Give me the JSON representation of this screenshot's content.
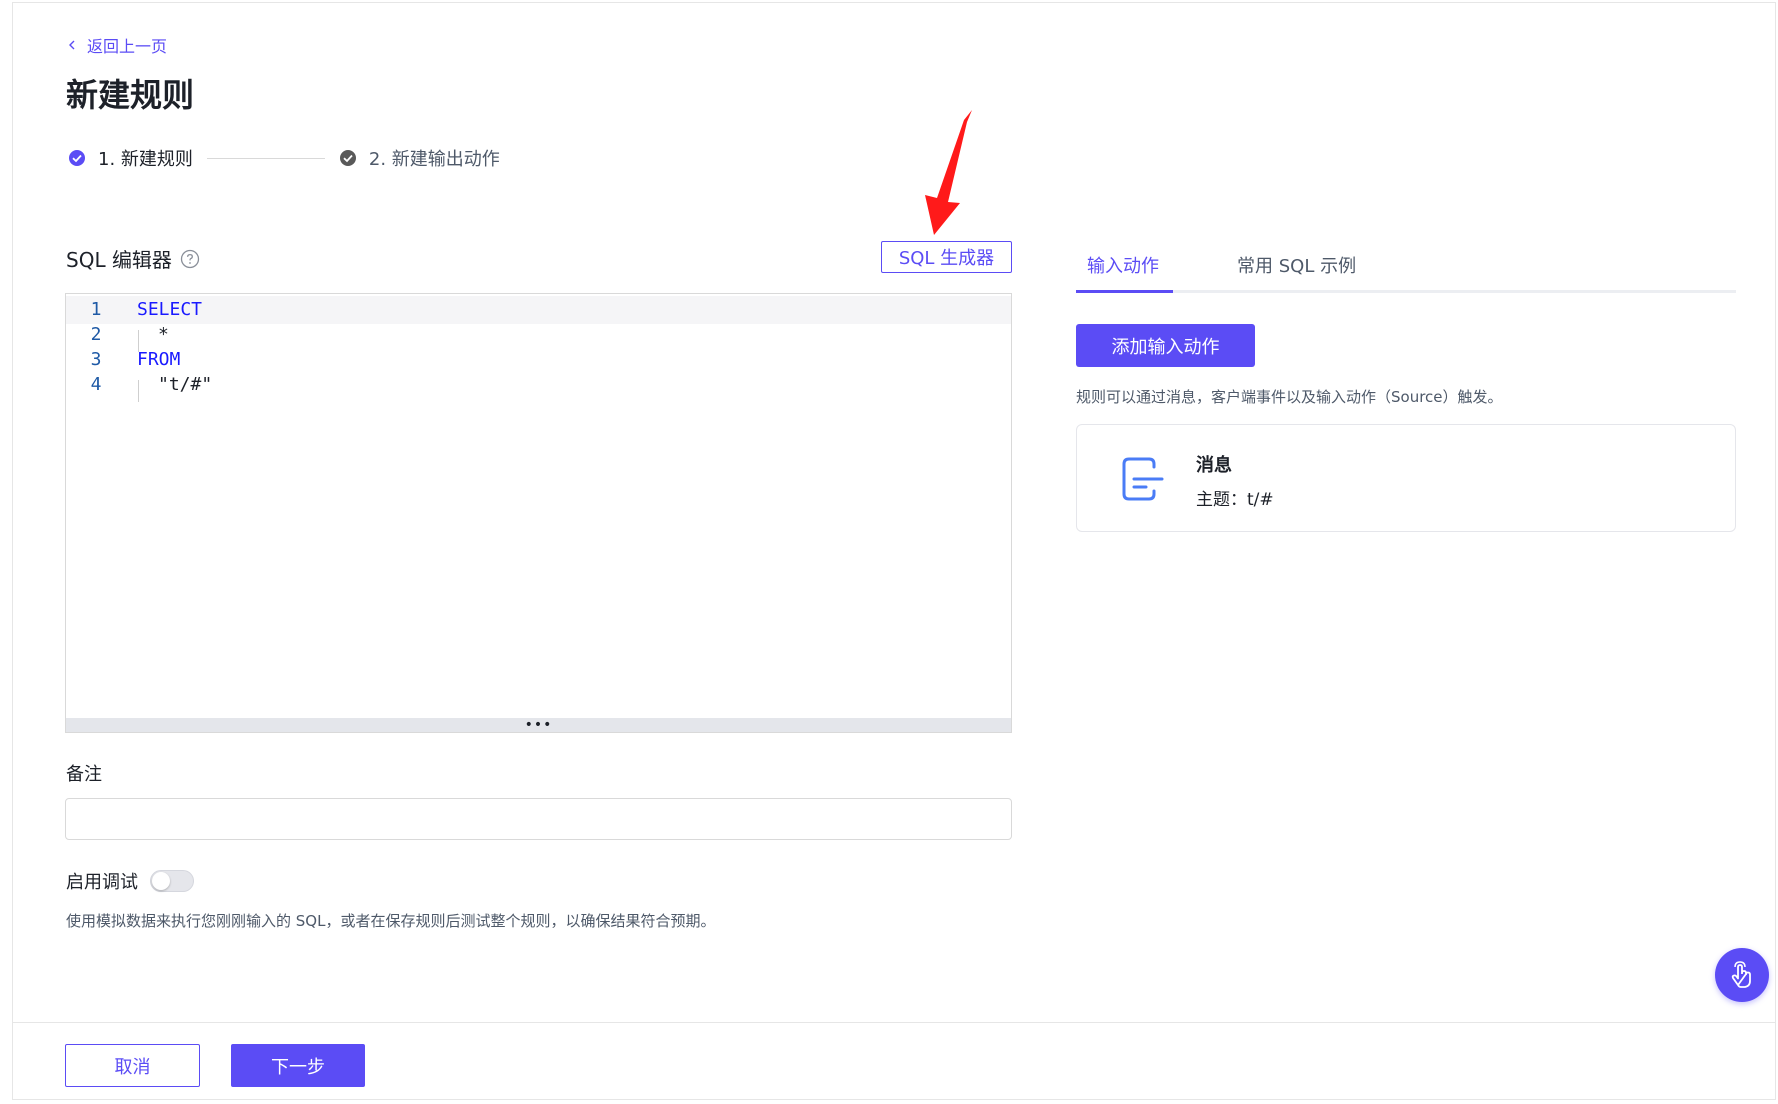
{
  "breadcrumb": {
    "back_label": "返回上一页"
  },
  "page": {
    "title": "新建规则"
  },
  "steps": [
    {
      "label": "1. 新建规则",
      "state": "active"
    },
    {
      "label": "2. 新建输出动作",
      "state": "pending"
    }
  ],
  "sql_editor": {
    "label": "SQL 编辑器",
    "generator_button": "SQL 生成器",
    "lines": [
      {
        "no": "1",
        "text": "SELECT",
        "kind": "keyword"
      },
      {
        "no": "2",
        "text": "*",
        "kind": "plain"
      },
      {
        "no": "3",
        "text": "FROM",
        "kind": "keyword"
      },
      {
        "no": "4",
        "text": "\"t/#\"",
        "kind": "plain"
      }
    ],
    "resize_handle": "•••"
  },
  "remark": {
    "label": "备注",
    "value": "",
    "placeholder": ""
  },
  "debug": {
    "label": "启用调试",
    "enabled": false,
    "description": "使用模拟数据来执行您刚刚输入的 SQL，或者在保存规则后测试整个规则，以确保结果符合预期。"
  },
  "right_panel": {
    "tabs": [
      {
        "label": "输入动作",
        "active": true
      },
      {
        "label": "常用 SQL 示例",
        "active": false
      }
    ],
    "add_button": "添加输入动作",
    "description": "规则可以通过消息，客户端事件以及输入动作（Source）触发。",
    "source_card": {
      "title": "消息",
      "topic": "主题：t/#",
      "icon": "message-source-icon"
    }
  },
  "footer": {
    "cancel_label": "取消",
    "next_label": "下一步"
  },
  "colors": {
    "accent": "#5b4cf5",
    "annotation_arrow": "#ff1a1a",
    "keyword": "#1a1aff"
  }
}
